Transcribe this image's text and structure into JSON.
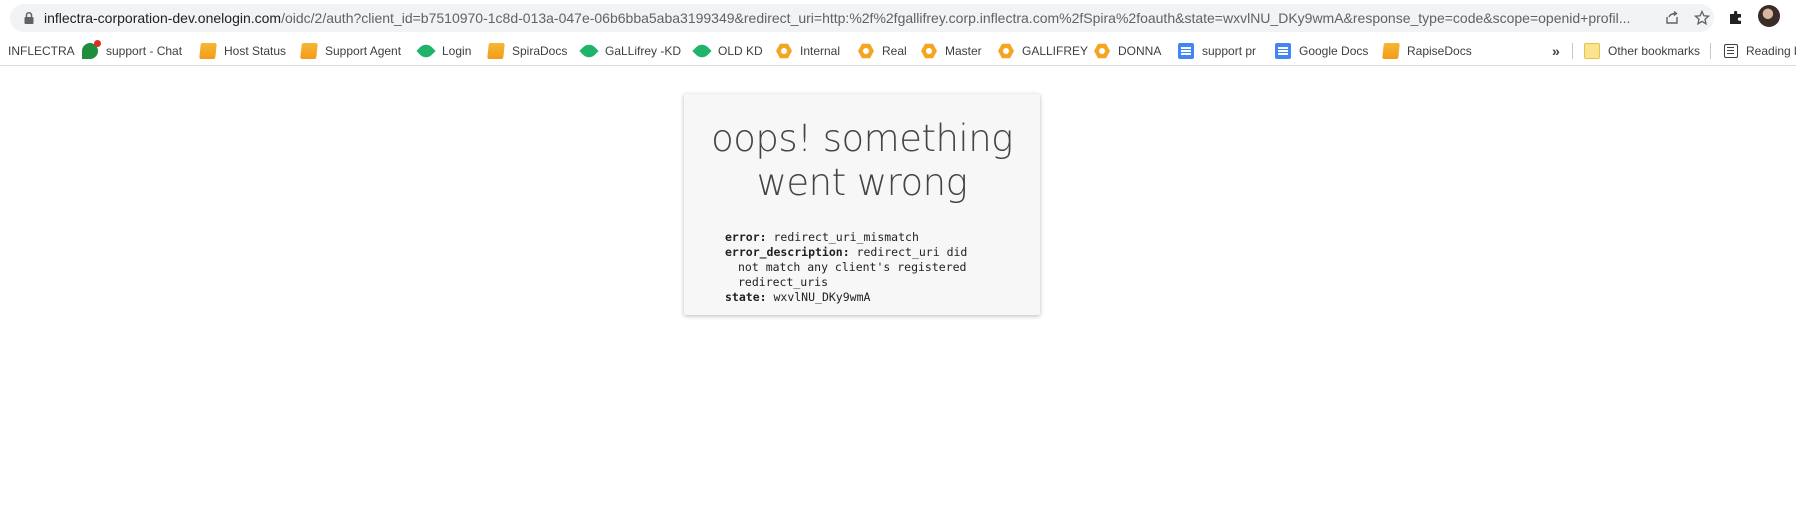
{
  "browser": {
    "url_host": "inflectra-corporation-dev.onelogin.com",
    "url_path": "/oidc/2/auth?client_id=b7510970-1c8d-013a-047e-06b6bba5aba3199349&redirect_uri=http:%2f%2fgallifrey.corp.inflectra.com%2fSpira%2foauth&state=wxvlNU_DKy9wmA&response_type=code&scope=openid+profil..."
  },
  "bookmarks": [
    {
      "label": "INFLECTRA",
      "icon": "none"
    },
    {
      "label": "support - Chat",
      "icon": "chat-icon"
    },
    {
      "label": "Host Status",
      "icon": "folder-icon"
    },
    {
      "label": "Support Agent",
      "icon": "folder-icon"
    },
    {
      "label": "Login",
      "icon": "leaf-icon"
    },
    {
      "label": "SpiraDocs",
      "icon": "folder-icon"
    },
    {
      "label": "GaLLifrey -KD",
      "icon": "leaf-icon"
    },
    {
      "label": "OLD KD",
      "icon": "leaf-icon"
    },
    {
      "label": "Internal",
      "icon": "hex-icon"
    },
    {
      "label": "Real",
      "icon": "hex-icon"
    },
    {
      "label": "Master",
      "icon": "hex-icon"
    },
    {
      "label": "GALLIFREY",
      "icon": "hex-icon"
    },
    {
      "label": "DONNA",
      "icon": "hex-icon"
    },
    {
      "label": "support pr",
      "icon": "google-docs-icon"
    },
    {
      "label": "Google Docs",
      "icon": "google-docs-icon"
    },
    {
      "label": "RapiseDocs",
      "icon": "folder-icon"
    }
  ],
  "bookmarks_overflow": "»",
  "other_bookmarks": "Other bookmarks",
  "reading_list": "Reading l",
  "error_card": {
    "title_line1": "oops! something",
    "title_line2": "went wrong",
    "error_key": "error:",
    "error_value": "redirect_uri_mismatch",
    "description_key": "error_description:",
    "description_value_1": "redirect_uri did",
    "description_value_2": "not match any client's registered",
    "description_value_3": "redirect_uris",
    "state_key": "state:",
    "state_value": "wxvlNU_DKy9wmA"
  },
  "colors": {
    "omnibox_bg": "#f1f3f4",
    "card_bg": "#f7f7f7",
    "title_text": "#444444"
  }
}
